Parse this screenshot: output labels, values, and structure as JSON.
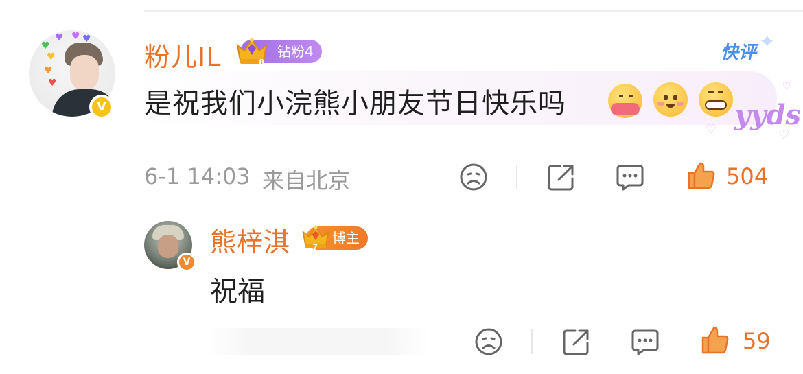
{
  "comment": {
    "username": "粉儿IL",
    "badge_label": "钻粉4",
    "badge_level_digit": "8",
    "quick_comment_label": "快评",
    "text": "是祝我们小浣熊小朋友节日快乐吗",
    "sticker_text": "yyds",
    "timestamp": "6-1 14:03",
    "location": "来自北京",
    "like_count": "504",
    "avatar_badge": "V"
  },
  "reply": {
    "username": "熊梓淇",
    "badge_label": "博主",
    "badge_level_digit": "7",
    "text": "祝福",
    "like_count": "59",
    "avatar_badge": "V"
  },
  "icons": {
    "dislike": "frown-face-icon",
    "share": "share-icon",
    "comment": "comment-bubble-icon",
    "like": "thumbs-up-icon"
  },
  "colors": {
    "username": "#e8732a",
    "diamond_badge": "#b27ee8",
    "blogger_badge": "#f08a2a",
    "quick_comment": "#4d8fe6",
    "meta_text": "#9a9a9a",
    "like": "#e8732a"
  }
}
